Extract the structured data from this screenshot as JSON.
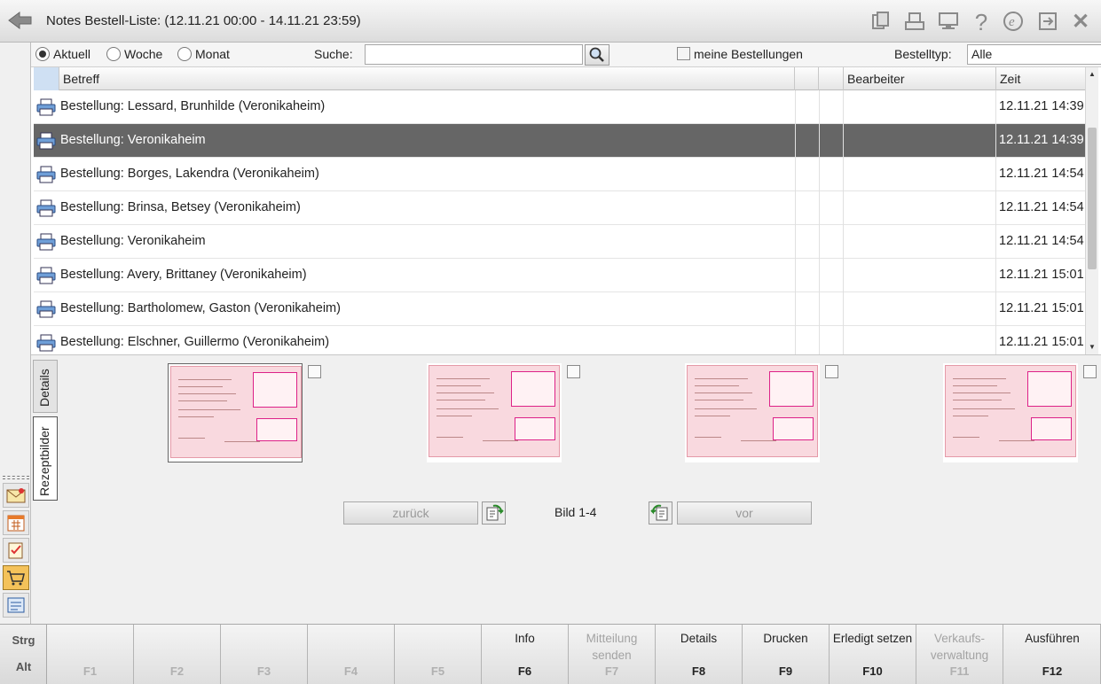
{
  "window": {
    "title": "Notes Bestell-Liste: (12.11.21 00:00 - 14.11.21 23:59)"
  },
  "titlebar_icons": [
    "copy-icon",
    "print-icon",
    "monitor-icon",
    "help-icon",
    "e-icon",
    "export-icon",
    "close-icon"
  ],
  "filter": {
    "radio_aktuell": "Aktuell",
    "radio_woche": "Woche",
    "radio_monat": "Monat",
    "selected": "Aktuell",
    "search_label": "Suche:",
    "search_value": "",
    "meine_bestellungen": "meine Bestellungen",
    "meine_bestellungen_checked": false,
    "bestelltyp_label": "Bestelltyp:",
    "bestelltyp_value": "Alle"
  },
  "table": {
    "columns": {
      "betreff": "Betreff",
      "bearbeiter": "Bearbeiter",
      "zeit": "Zeit"
    },
    "rows": [
      {
        "subject": "Bestellung: Lessard, Brunhilde (Veronikaheim)",
        "zeit": "12.11.21 14:39"
      },
      {
        "subject": "Bestellung: Veronikaheim",
        "zeit": "12.11.21 14:39"
      },
      {
        "subject": "Bestellung: Borges, Lakendra (Veronikaheim)",
        "zeit": "12.11.21 14:54"
      },
      {
        "subject": "Bestellung: Brinsa, Betsey (Veronikaheim)",
        "zeit": "12.11.21 14:54"
      },
      {
        "subject": "Bestellung: Veronikaheim",
        "zeit": "12.11.21 14:54"
      },
      {
        "subject": "Bestellung: Avery, Brittaney (Veronikaheim)",
        "zeit": "12.11.21 15:01"
      },
      {
        "subject": "Bestellung: Bartholomew, Gaston (Veronikaheim)",
        "zeit": "12.11.21 15:01"
      },
      {
        "subject": "Bestellung: Elschner, Guillermo (Veronikaheim)",
        "zeit": "12.11.21 15:01"
      }
    ],
    "selected_row": 1
  },
  "lower": {
    "tab_details": "Details",
    "tab_rezeptbilder": "Rezeptbilder",
    "active_tab": "Rezeptbilder",
    "zurueck": "zurück",
    "vor": "vor",
    "bild": "Bild 1-4"
  },
  "fkeys": {
    "strg": "Strg",
    "alt": "Alt",
    "keys": [
      {
        "label": "",
        "key": "F1",
        "enabled": false
      },
      {
        "label": "",
        "key": "F2",
        "enabled": false
      },
      {
        "label": "",
        "key": "F3",
        "enabled": false
      },
      {
        "label": "",
        "key": "F4",
        "enabled": false
      },
      {
        "label": "",
        "key": "F5",
        "enabled": false
      },
      {
        "label": "Info",
        "key": "F6",
        "enabled": true
      },
      {
        "label": "Mitteilung senden",
        "key": "F7",
        "enabled": false
      },
      {
        "label": "Details",
        "key": "F8",
        "enabled": true
      },
      {
        "label": "Drucken",
        "key": "F9",
        "enabled": true
      },
      {
        "label": "Erledigt setzen",
        "key": "F10",
        "enabled": true
      },
      {
        "label": "Verkaufs-verwaltung",
        "key": "F11",
        "enabled": false
      },
      {
        "label": "Ausführen",
        "key": "F12",
        "enabled": true
      }
    ]
  }
}
